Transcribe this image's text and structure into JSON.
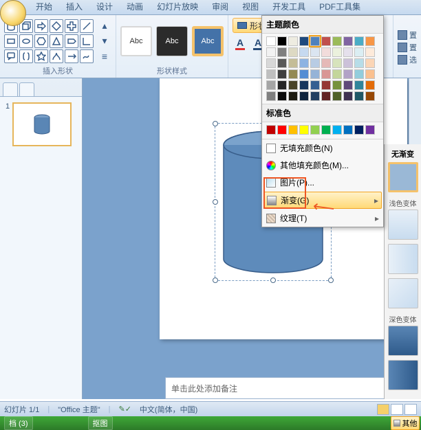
{
  "tabs": [
    "开始",
    "插入",
    "设计",
    "动画",
    "幻灯片放映",
    "审阅",
    "视图",
    "开发工具",
    "PDF工具集"
  ],
  "group_insert_shapes": "插入形状",
  "group_shape_styles": "形状样式",
  "style_swatch_text": "Abc",
  "fill_label": "形状填充",
  "arrange": {
    "front": "置",
    "back": "置",
    "sel": "选"
  },
  "popup": {
    "theme": "主题颜色",
    "standard": "标准色",
    "nofill": "无填充颜色(N)",
    "more": "其他填充颜色(M)...",
    "picture": "图片(P)...",
    "gradient": "渐变(G)",
    "texture": "纹理(T)"
  },
  "theme_colors": [
    [
      "#ffffff",
      "#000000",
      "#eeece1",
      "#1f497d",
      "#4f81bd",
      "#c0504d",
      "#9bbb59",
      "#8064a2",
      "#4bacc6",
      "#f79646"
    ],
    [
      "#f2f2f2",
      "#7f7f7f",
      "#ddd9c3",
      "#c6d9f0",
      "#dbe5f1",
      "#f2dcdb",
      "#ebf1dd",
      "#e5e0ec",
      "#dbeef3",
      "#fdeada"
    ],
    [
      "#d8d8d8",
      "#595959",
      "#c4bd97",
      "#8db3e2",
      "#b8cce4",
      "#e5b9b7",
      "#d7e3bc",
      "#ccc1d9",
      "#b7dde8",
      "#fbd5b5"
    ],
    [
      "#bfbfbf",
      "#3f3f3f",
      "#938953",
      "#548dd4",
      "#95b3d7",
      "#d99694",
      "#c3d69b",
      "#b2a2c7",
      "#92cddc",
      "#fac08f"
    ],
    [
      "#a5a5a5",
      "#262626",
      "#494429",
      "#17365d",
      "#366092",
      "#953734",
      "#76923c",
      "#5f497a",
      "#31859b",
      "#e36c09"
    ],
    [
      "#7f7f7f",
      "#0c0c0c",
      "#1d1b10",
      "#0f243e",
      "#244061",
      "#632423",
      "#4f6128",
      "#3f3151",
      "#205867",
      "#974806"
    ]
  ],
  "standard_colors": [
    "#c00000",
    "#ff0000",
    "#ffc000",
    "#ffff00",
    "#92d050",
    "#00b050",
    "#00b0f0",
    "#0070c0",
    "#002060",
    "#7030a0"
  ],
  "grad": {
    "none": "无渐变",
    "light": "浅色变体",
    "dark": "深色变体",
    "other_grad": "其他"
  },
  "notes_placeholder": "单击此处添加备注",
  "status": {
    "slide": "幻灯片 1/1",
    "theme": "\"Office 主题\"",
    "lang": "中文(简体，中国)"
  },
  "taskbar": {
    "item1": "档 (3)",
    "item2": "抠图"
  },
  "thumb_num": "1"
}
